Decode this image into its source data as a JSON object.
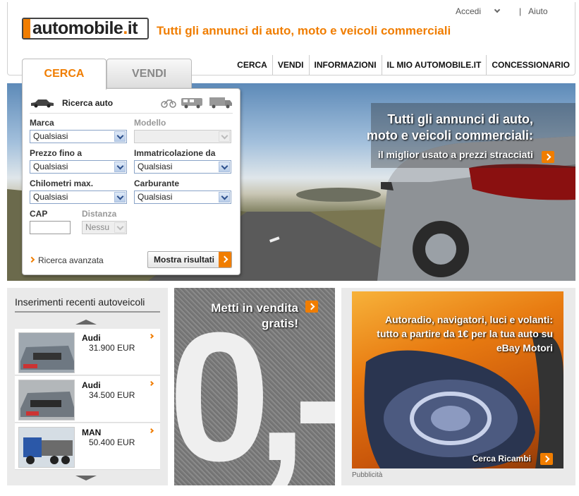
{
  "header": {
    "logo_text": "automobile",
    "logo_dot": ".",
    "logo_tld": "it",
    "slogan": "Tutti gli annunci di auto, moto e veicoli commerciali",
    "login_label": "Accedi",
    "help_label": "Aiuto",
    "separator": "|"
  },
  "nav": {
    "items": [
      "CERCA",
      "VENDI",
      "INFORMAZIONI",
      "IL MIO AUTOMOBILE.IT",
      "CONCESSIONARIO"
    ]
  },
  "search_panel": {
    "tabs": [
      "CERCA",
      "VENDI"
    ],
    "active_tab": "CERCA",
    "title": "Ricerca auto",
    "fields": {
      "marca": {
        "label": "Marca",
        "value": "Qualsiasi"
      },
      "modello": {
        "label": "Modello",
        "value": ""
      },
      "prezzo": {
        "label": "Prezzo fino a",
        "value": "Qualsiasi"
      },
      "immatricolazione": {
        "label": "Immatricolazione da",
        "value": "Qualsiasi"
      },
      "chilometri": {
        "label": "Chilometri max.",
        "value": "Qualsiasi"
      },
      "carburante": {
        "label": "Carburante",
        "value": "Qualsiasi"
      },
      "cap": {
        "label": "CAP",
        "value": ""
      },
      "distanza": {
        "label": "Distanza",
        "value": "Nessu"
      }
    },
    "advanced_link": "Ricerca avanzata",
    "submit_label": "Mostra risultati"
  },
  "hero": {
    "line1": "Tutti gli annunci di auto,",
    "line2": "moto e veicoli commerciali:",
    "line3": "il miglior usato a prezzi stracciati"
  },
  "recent": {
    "title": "Inserimenti recenti autoveicoli",
    "items": [
      {
        "name": "Audi",
        "price": "31.900 EUR"
      },
      {
        "name": "Audi",
        "price": "34.500 EUR"
      },
      {
        "name": "MAN",
        "price": "50.400 EUR"
      }
    ]
  },
  "sell_promo": {
    "line1": "Metti in vendita",
    "line2": "gratis!",
    "big_text": "0,-"
  },
  "ad": {
    "line1": "Autoradio, navigatori, luci e volanti:",
    "line2": "tutto a partire da 1€ per la tua auto su",
    "line3": "eBay Motori",
    "cta": "Cerca Ricambi",
    "sponsor_label": "Pubblicità"
  },
  "colors": {
    "accent": "#f07d00",
    "nav_text": "#111111",
    "select_border": "#8aa4c8"
  }
}
